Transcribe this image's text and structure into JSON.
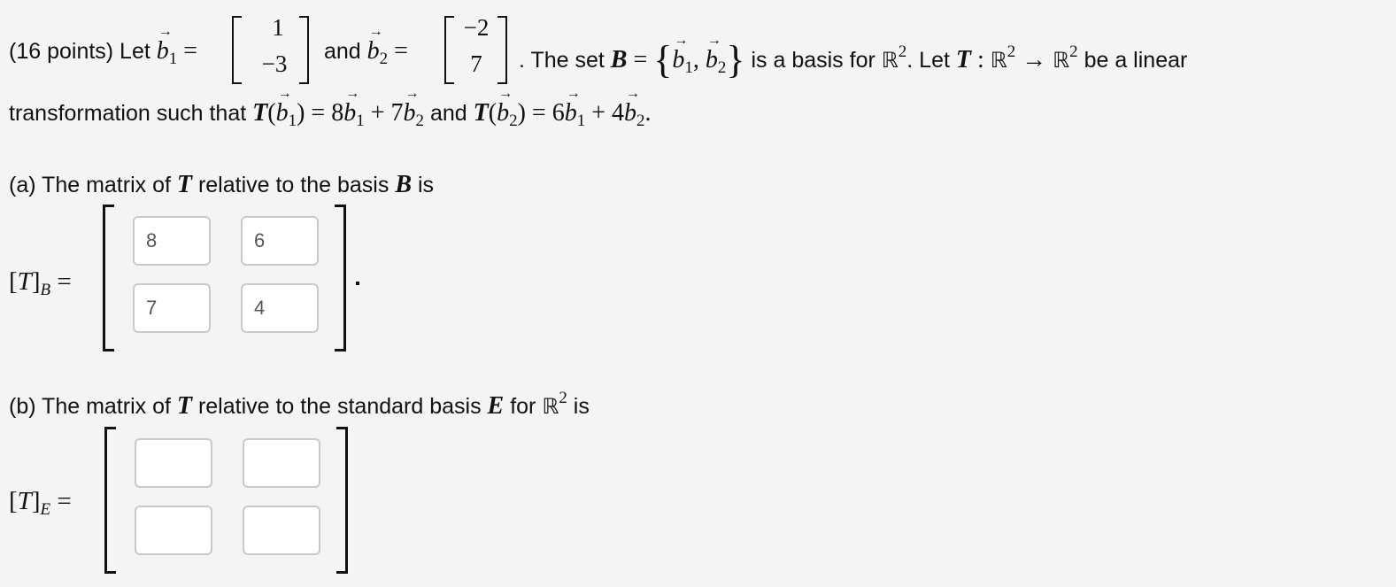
{
  "problem": {
    "points_label": "(16 points) Let",
    "and_label": "and",
    "set_text": ". The set",
    "basis_text": "is a basis for",
    "let_text": ". Let",
    "be_linear_text": "be a linear",
    "line2_prefix": "transformation such that",
    "and2": "and",
    "b1": [
      "1",
      "-3"
    ],
    "b2": [
      "-2",
      "7"
    ],
    "b1_name": "b",
    "b1_sub": "1",
    "b2_sub": "2",
    "set_name": "B",
    "space": "ℝ",
    "dim": "2",
    "map_name": "T",
    "T_b1": {
      "c1": "8",
      "c2": "7"
    },
    "T_b2": {
      "c1": "6",
      "c2": "4"
    }
  },
  "part_a": {
    "prefix": "(a) The matrix of",
    "middle": "relative to the basis",
    "suffix": "is",
    "matrix_label_sub": "B",
    "inputs": [
      [
        "8",
        "6"
      ],
      [
        "7",
        "4"
      ]
    ]
  },
  "part_b": {
    "prefix": "(b) The matrix of",
    "middle": "relative to the standard basis",
    "basis_name": "E",
    "for_text": "for",
    "suffix": "is",
    "matrix_label_sub": "E",
    "inputs": [
      [
        "",
        ""
      ],
      [
        "",
        ""
      ]
    ]
  }
}
